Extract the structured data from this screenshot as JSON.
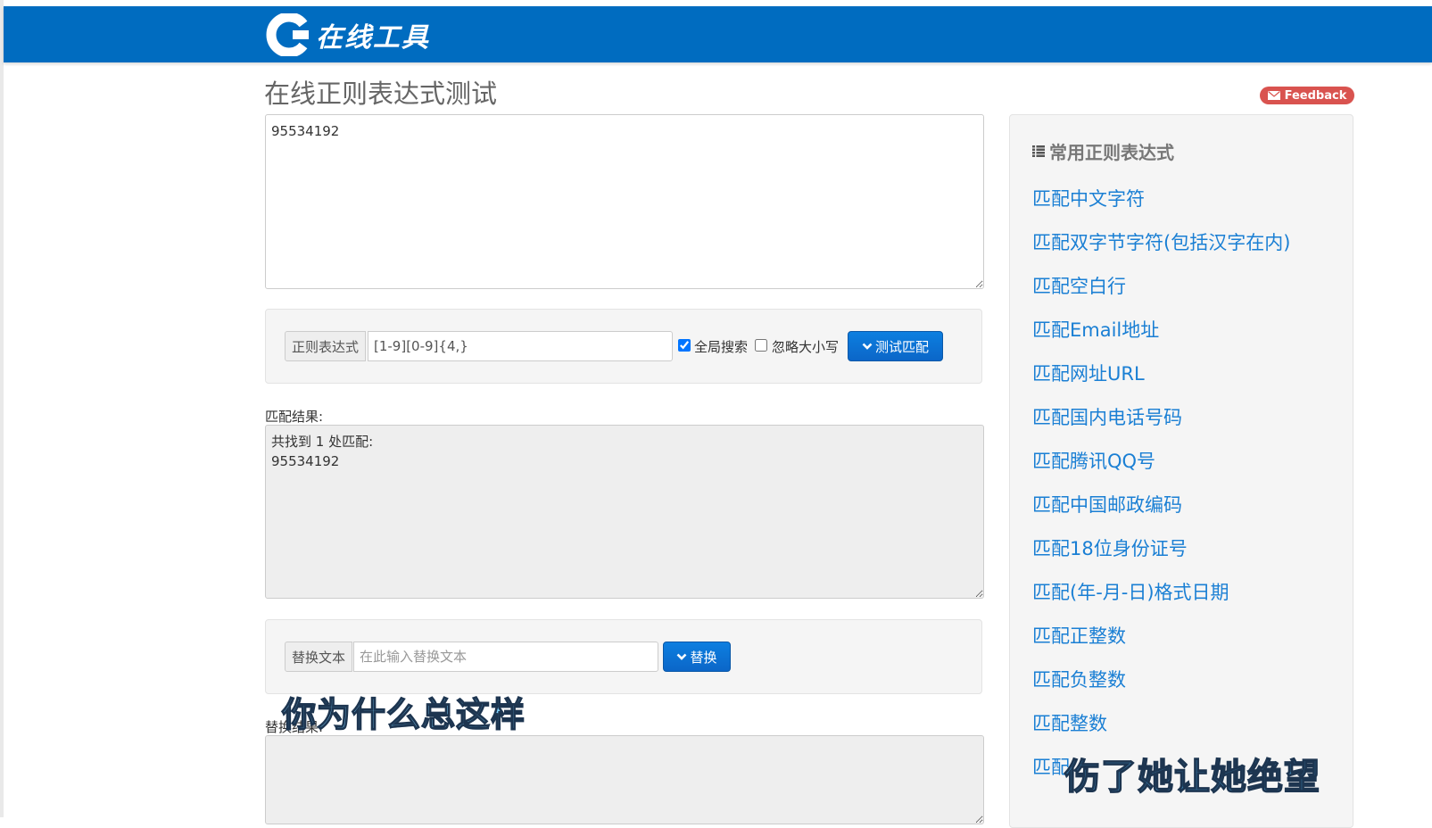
{
  "header": {
    "brand_text": "在线工具",
    "bg_color": "#006cc0"
  },
  "page": {
    "title": "在线正则表达式测试"
  },
  "feedback": {
    "label": "Feedback",
    "color": "#d9534f"
  },
  "source_text": {
    "value": "95534192"
  },
  "regex_panel": {
    "addon_label": "正则表达式",
    "pattern": "[1-9][0-9]{4,}",
    "global_label": "全局搜索",
    "global_checked": true,
    "ignore_case_label": "忽略大小写",
    "ignore_case_checked": false,
    "test_button": "测试匹配"
  },
  "match_result": {
    "label": "匹配结果:",
    "value": "共找到 1 处匹配:\n95534192"
  },
  "replace_panel": {
    "addon_label": "替换文本",
    "placeholder": "在此输入替换文本",
    "button": "替换"
  },
  "replace_result": {
    "label": "替换结果:",
    "value": ""
  },
  "sidebar": {
    "title": "常用正则表达式",
    "items": [
      "匹配中文字符",
      "匹配双字节字符(包括汉字在内)",
      "匹配空白行",
      "匹配Email地址",
      "匹配网址URL",
      "匹配国内电话号码",
      "匹配腾讯QQ号",
      "匹配中国邮政编码",
      "匹配18位身份证号",
      "匹配(年-月-日)格式日期",
      "匹配正整数",
      "匹配负整数",
      "匹配整数",
      "匹配"
    ]
  },
  "overlay_captions": {
    "left": "你为什么总这样",
    "right": "伤了她让她绝望"
  },
  "colors": {
    "link": "#1a7fd4",
    "button": "#0b66c8"
  }
}
